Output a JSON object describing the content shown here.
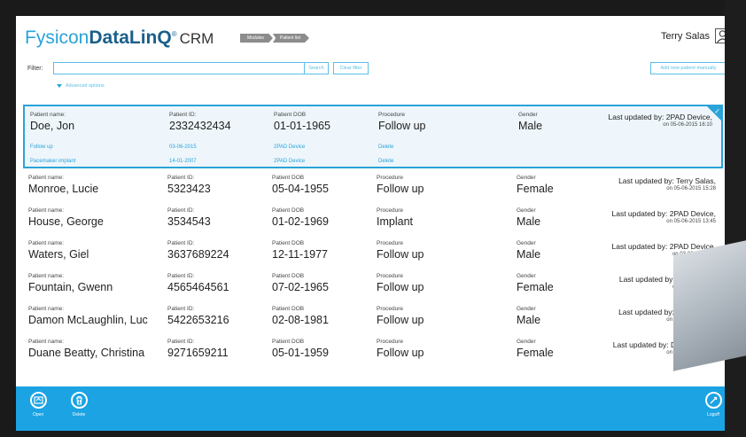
{
  "header": {
    "logo": {
      "part1": "Fysicon",
      "part2": "DataLinQ",
      "reg": "®",
      "part3": "CRM"
    },
    "breadcrumb": [
      "Modules",
      "Patient list"
    ],
    "user_name": "Terry Salas"
  },
  "filter": {
    "label": "Filter:",
    "value": "",
    "search_label": "Search",
    "clear_label": "Clear filter",
    "add_label": "Add new patient manually",
    "advanced_label": "Advanced options"
  },
  "labels": {
    "name": "Patient name:",
    "id": "Patient ID:",
    "dob": "Patient DOB",
    "procedure": "Procedure",
    "gender": "Gender"
  },
  "patients": [
    {
      "name": "Doe, Jon",
      "id": "2332432434",
      "dob": "01-01-1965",
      "procedure": "Follow up",
      "gender": "Male",
      "updated_by": "Last updated by: 2PAD Device,",
      "updated_on": "on 05-06-2015 16:10"
    },
    {
      "name": "Monroe, Lucie",
      "id": "5323423",
      "dob": "05-04-1955",
      "procedure": "Follow up",
      "gender": "Female",
      "updated_by": "Last updated by: Terry Salas,",
      "updated_on": "on 05-06-2015 15:28"
    },
    {
      "name": "House, George",
      "id": "3534543",
      "dob": "01-02-1969",
      "procedure": "Implant",
      "gender": "Male",
      "updated_by": "Last updated by: 2PAD Device,",
      "updated_on": "on 05-06-2015 13:45"
    },
    {
      "name": "Waters, Giel",
      "id": "3637689224",
      "dob": "12-11-1977",
      "procedure": "Follow up",
      "gender": "Male",
      "updated_by": "Last updated by: 2PAD Device,",
      "updated_on": "on 03-06-2015 14:"
    },
    {
      "name": "Fountain, Gwenn",
      "id": "4565464561",
      "dob": "07-02-1965",
      "procedure": "Follow up",
      "gender": "Female",
      "updated_by": "Last updated by: Dr. Davidso",
      "updated_on": "on 03-06-2015 12:"
    },
    {
      "name": "Damon McLaughlin, Luc",
      "id": "5422653216",
      "dob": "02-08-1981",
      "procedure": "Follow up",
      "gender": "Male",
      "updated_by": "Last updated by: Terry Salas,",
      "updated_on": "on 03-06-2015 12:00"
    },
    {
      "name": "Duane Beatty, Christina",
      "id": "9271659211",
      "dob": "05-01-1959",
      "procedure": "Follow up",
      "gender": "Female",
      "updated_by": "Last updated by: Dr. Davidson,",
      "updated_on": "on 02-06-2015 17:00"
    }
  ],
  "sessions": [
    {
      "procedure": "Follow up",
      "date": "03-06-2015",
      "source": "2PAD Device",
      "action": "Delete"
    },
    {
      "procedure": "Pacemaker implant",
      "date": "14-01-2007",
      "source": "2PAD Device",
      "action": "Delete"
    }
  ],
  "footer": {
    "open": "Open",
    "delete": "Delete",
    "logoff": "Logoff"
  },
  "colors": {
    "accent": "#1ba3e3",
    "brand_dark": "#1a5f8a"
  }
}
